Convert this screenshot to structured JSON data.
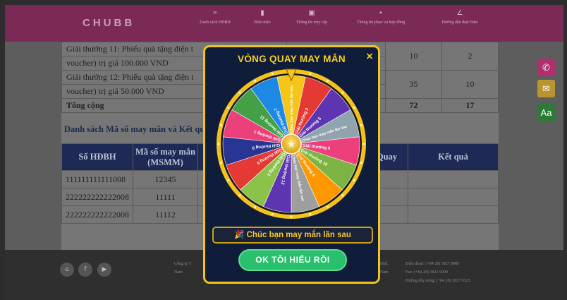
{
  "header": {
    "logo": "CHUBB",
    "nav": [
      {
        "icon": "list-icon",
        "label": "Danh sách HĐBH"
      },
      {
        "icon": "file-icon",
        "label": "Biểu mẫu"
      },
      {
        "icon": "account-icon",
        "label": "Thông tin truy cập"
      },
      {
        "icon": "chat-icon",
        "label": "Thông tin phục vụ hợp đồng"
      },
      {
        "icon": "edit-icon",
        "label": "Hướng dẫn thực hiện"
      }
    ]
  },
  "prize_table": {
    "rows": [
      {
        "line1": "Giải thưởng 11: Phiếu quà tặng điện t",
        "line2": "voucher) trị giá 100.000 VND",
        "qty": "10",
        "remaining": "2"
      },
      {
        "line1": "Giải thưởng 12: Phiếu quà tặng điện t",
        "line2": "voucher) trị giá 50.000 VND",
        "qty": "35",
        "remaining": "10"
      }
    ],
    "total": {
      "label": "Tổng cộng",
      "qty": "72",
      "remaining": "17"
    }
  },
  "results": {
    "title": "Danh sách Mã số may mắn và Kết qu",
    "headers": [
      "Số HĐBH",
      "Mã số may mắn (MSMM)",
      "Quay",
      "Kết quả"
    ],
    "rows": [
      [
        "111111111111008",
        "12345"
      ],
      [
        "222222222222008",
        "11111"
      ],
      [
        "222222222222008",
        "11112"
      ]
    ]
  },
  "side_buttons": [
    {
      "icon": "phone-icon",
      "color": "#b0306e"
    },
    {
      "icon": "mail-icon",
      "color": "#b8952e"
    },
    {
      "icon": "font-size-icon",
      "color": "#2d7a38",
      "label": "Aa"
    }
  ],
  "footer": {
    "company": [
      "Công ty T",
      "Nam"
    ],
    "address": [
      "Huế,",
      "Nam"
    ],
    "contact": [
      "Điện thoại: (+84 28) 3827 8989",
      "Fax: (+84 28) 3821 9000",
      "Đường dây nóng: (+84 28) 3827 9323"
    ]
  },
  "modal": {
    "title": "VÒNG QUAY MAY MẮN",
    "close": "×",
    "result_icon": "🎉",
    "result_text": "Chúc bạn may mắn lần sau",
    "ok_label": "OK TÔI HIỂU RỒI",
    "wheel_segments": [
      {
        "label": "Chúc bạn may mắn lần sau",
        "color": "#f5c518"
      },
      {
        "label": "Giải thưởng 3",
        "color": "#e53935"
      },
      {
        "label": "Giải thưởng 5",
        "color": "#5e35b1"
      },
      {
        "label": "Chúc bạn may mắn lần sau",
        "color": "#90a4ae"
      },
      {
        "label": "Giải thưởng 8",
        "color": "#ec407a"
      },
      {
        "label": "Giải thưởng 10",
        "color": "#7cb342"
      },
      {
        "label": "Giải thưởng 4",
        "color": "#ff9800"
      },
      {
        "label": "Chúc bạn may mắn lần sau",
        "color": "#9e9e9e"
      },
      {
        "label": "Giải thưởng 12",
        "color": "#5e35b1"
      },
      {
        "label": "Giải thưởng 2",
        "color": "#8bc34a"
      },
      {
        "label": "Giải thưởng 6",
        "color": "#e53935"
      },
      {
        "label": "Giải thưởng 9",
        "color": "#283593"
      },
      {
        "label": "Giải thưởng 1",
        "color": "#ec407a"
      },
      {
        "label": "Giải thưởng 11",
        "color": "#43a047"
      },
      {
        "label": "Giải thưởng 7",
        "color": "#1e88e5"
      }
    ]
  }
}
